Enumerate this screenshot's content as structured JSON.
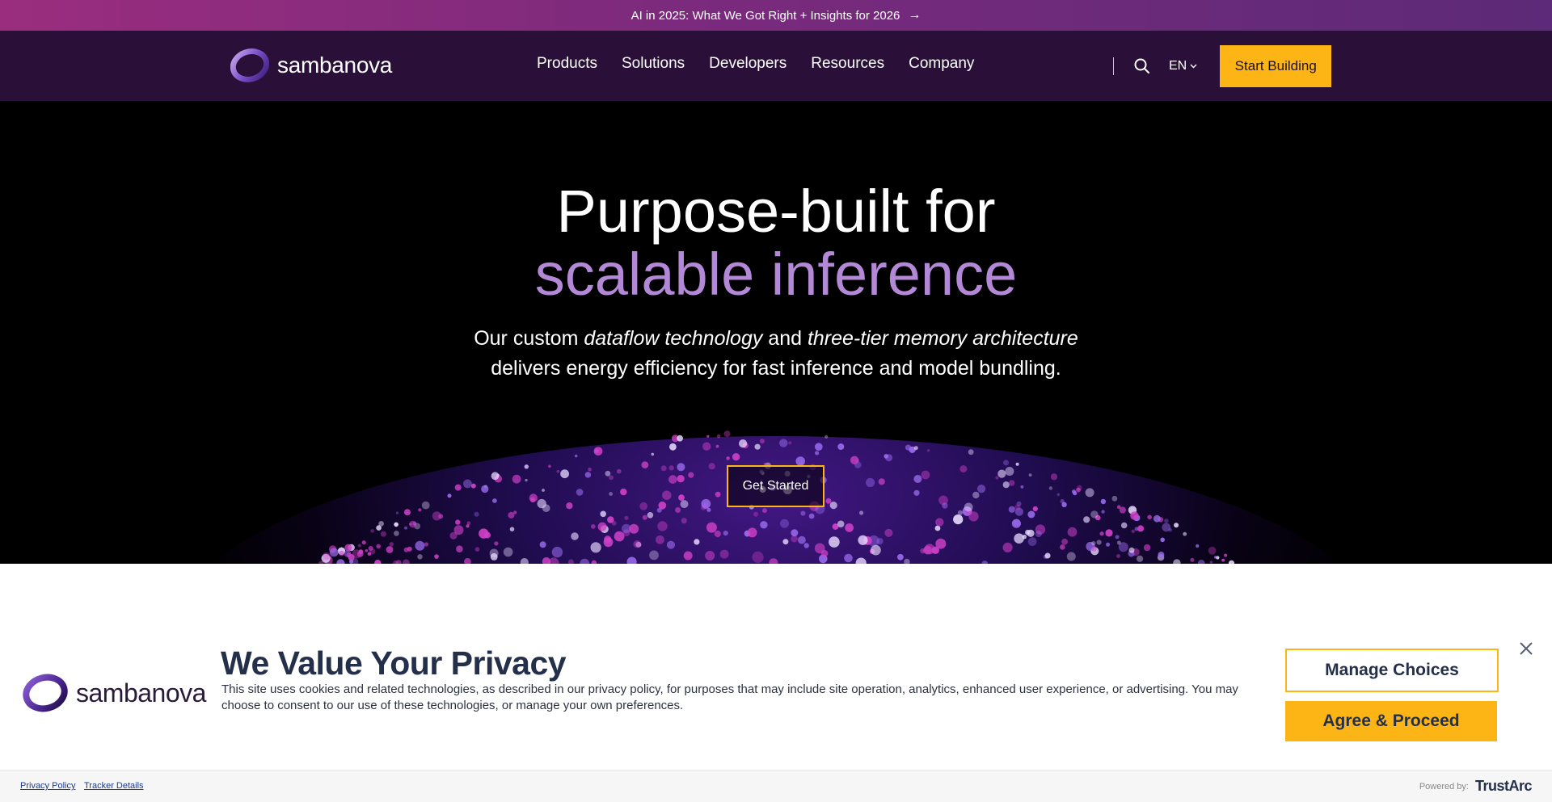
{
  "announcement": {
    "text": "AI in 2025: What We Got Right + Insights for 2026",
    "arrow": "→"
  },
  "header": {
    "logo_text": "sambanova",
    "menu": [
      "Products",
      "Solutions",
      "Developers",
      "Resources",
      "Company"
    ],
    "language": "EN",
    "cta_label": "Start Building"
  },
  "hero": {
    "title_line1": "Purpose-built for",
    "title_line2": "scalable inference",
    "subtitle_a": "Our custom ",
    "subtitle_em1": "dataflow technology",
    "subtitle_b": " and ",
    "subtitle_em2": "three-tier memory architecture",
    "subtitle_line2": "delivers energy efficiency for fast inference and model bundling.",
    "cta_label": "Get Started"
  },
  "consent": {
    "logo_text": "sambanova",
    "title": "We Value Your Privacy",
    "body": "This site uses cookies and related technologies, as described in our privacy policy, for purposes that may include site operation, analytics, enhanced user experience, or advertising. You may choose to consent to our use of these technologies, or manage your own preferences.",
    "manage_label": "Manage Choices",
    "agree_label": "Agree & Proceed"
  },
  "footer": {
    "privacy_link": "Privacy Policy",
    "tracker_link": "Tracker Details",
    "powered_label": "Powered by:",
    "powered_brand": "TrustArc"
  },
  "colors": {
    "accent": "#fdb515",
    "nav_bg": "#2a1038",
    "hero_accent": "#b388d6"
  }
}
